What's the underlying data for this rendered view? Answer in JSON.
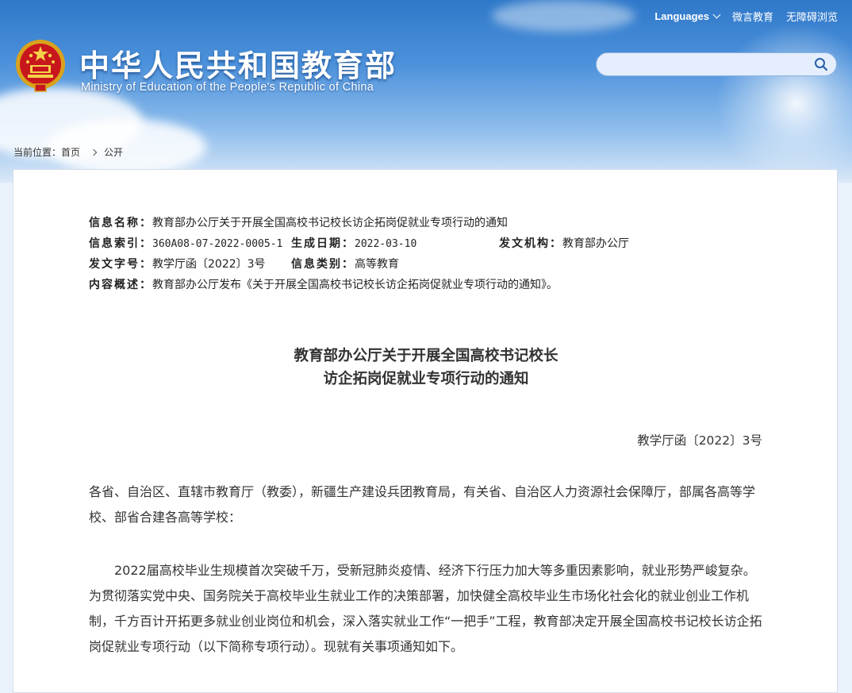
{
  "header": {
    "title_cn": "中华人民共和国教育部",
    "title_en": "Ministry of Education of the People's Republic of China",
    "links": {
      "languages": "Languages",
      "weibo": "微言教育",
      "accessible": "无障碍浏览"
    },
    "search": {
      "placeholder": ""
    }
  },
  "breadcrumb": {
    "label": "当前位置：",
    "home": "首页",
    "current": "公开"
  },
  "info": {
    "name_label": "信息名称：",
    "name_value": "教育部办公厅关于开展全国高校书记校长访企拓岗促就业专项行动的通知",
    "index_label": "信息索引：",
    "index_value": "360A08-07-2022-0005-1",
    "date_label": "生成日期：",
    "date_value": "2022-03-10",
    "org_label": "发文机构：",
    "org_value": "教育部办公厅",
    "docno_label": "发文字号：",
    "docno_value": "教学厅函〔2022〕3号",
    "category_label": "信息类别：",
    "category_value": "高等教育",
    "summary_label": "内容概述：",
    "summary_value": "教育部办公厅发布《关于开展全国高校书记校长访企拓岗促就业专项行动的通知》。"
  },
  "document": {
    "title_line1": "教育部办公厅关于开展全国高校书记校长",
    "title_line2": "访企拓岗促就业专项行动的通知",
    "doc_number": "教学厅函〔2022〕3号",
    "salutation": "各省、自治区、直辖市教育厅（教委），新疆生产建设兵团教育局，有关省、自治区人力资源社会保障厅，部属各高等学校、部省合建各高等学校：",
    "paragraph1": "2022届高校毕业生规模首次突破千万，受新冠肺炎疫情、经济下行压力加大等多重因素影响，就业形势严峻复杂。为贯彻落实党中央、国务院关于高校毕业生就业工作的决策部署，加快健全高校毕业生市场化社会化的就业创业工作机制，千方百计开拓更多就业创业岗位和机会，深入落实就业工作“一把手”工程，教育部决定开展全国高校书记校长访企拓岗促就业专项行动（以下简称专项行动）。现就有关事项通知如下。"
  },
  "colors": {
    "banner_top": "#2f78c9",
    "panel_bg": "#ffffff",
    "text": "#333333"
  },
  "icons": [
    "national-emblem-icon",
    "chevron-down-icon",
    "search-icon",
    "breadcrumb-arrow-icon"
  ]
}
